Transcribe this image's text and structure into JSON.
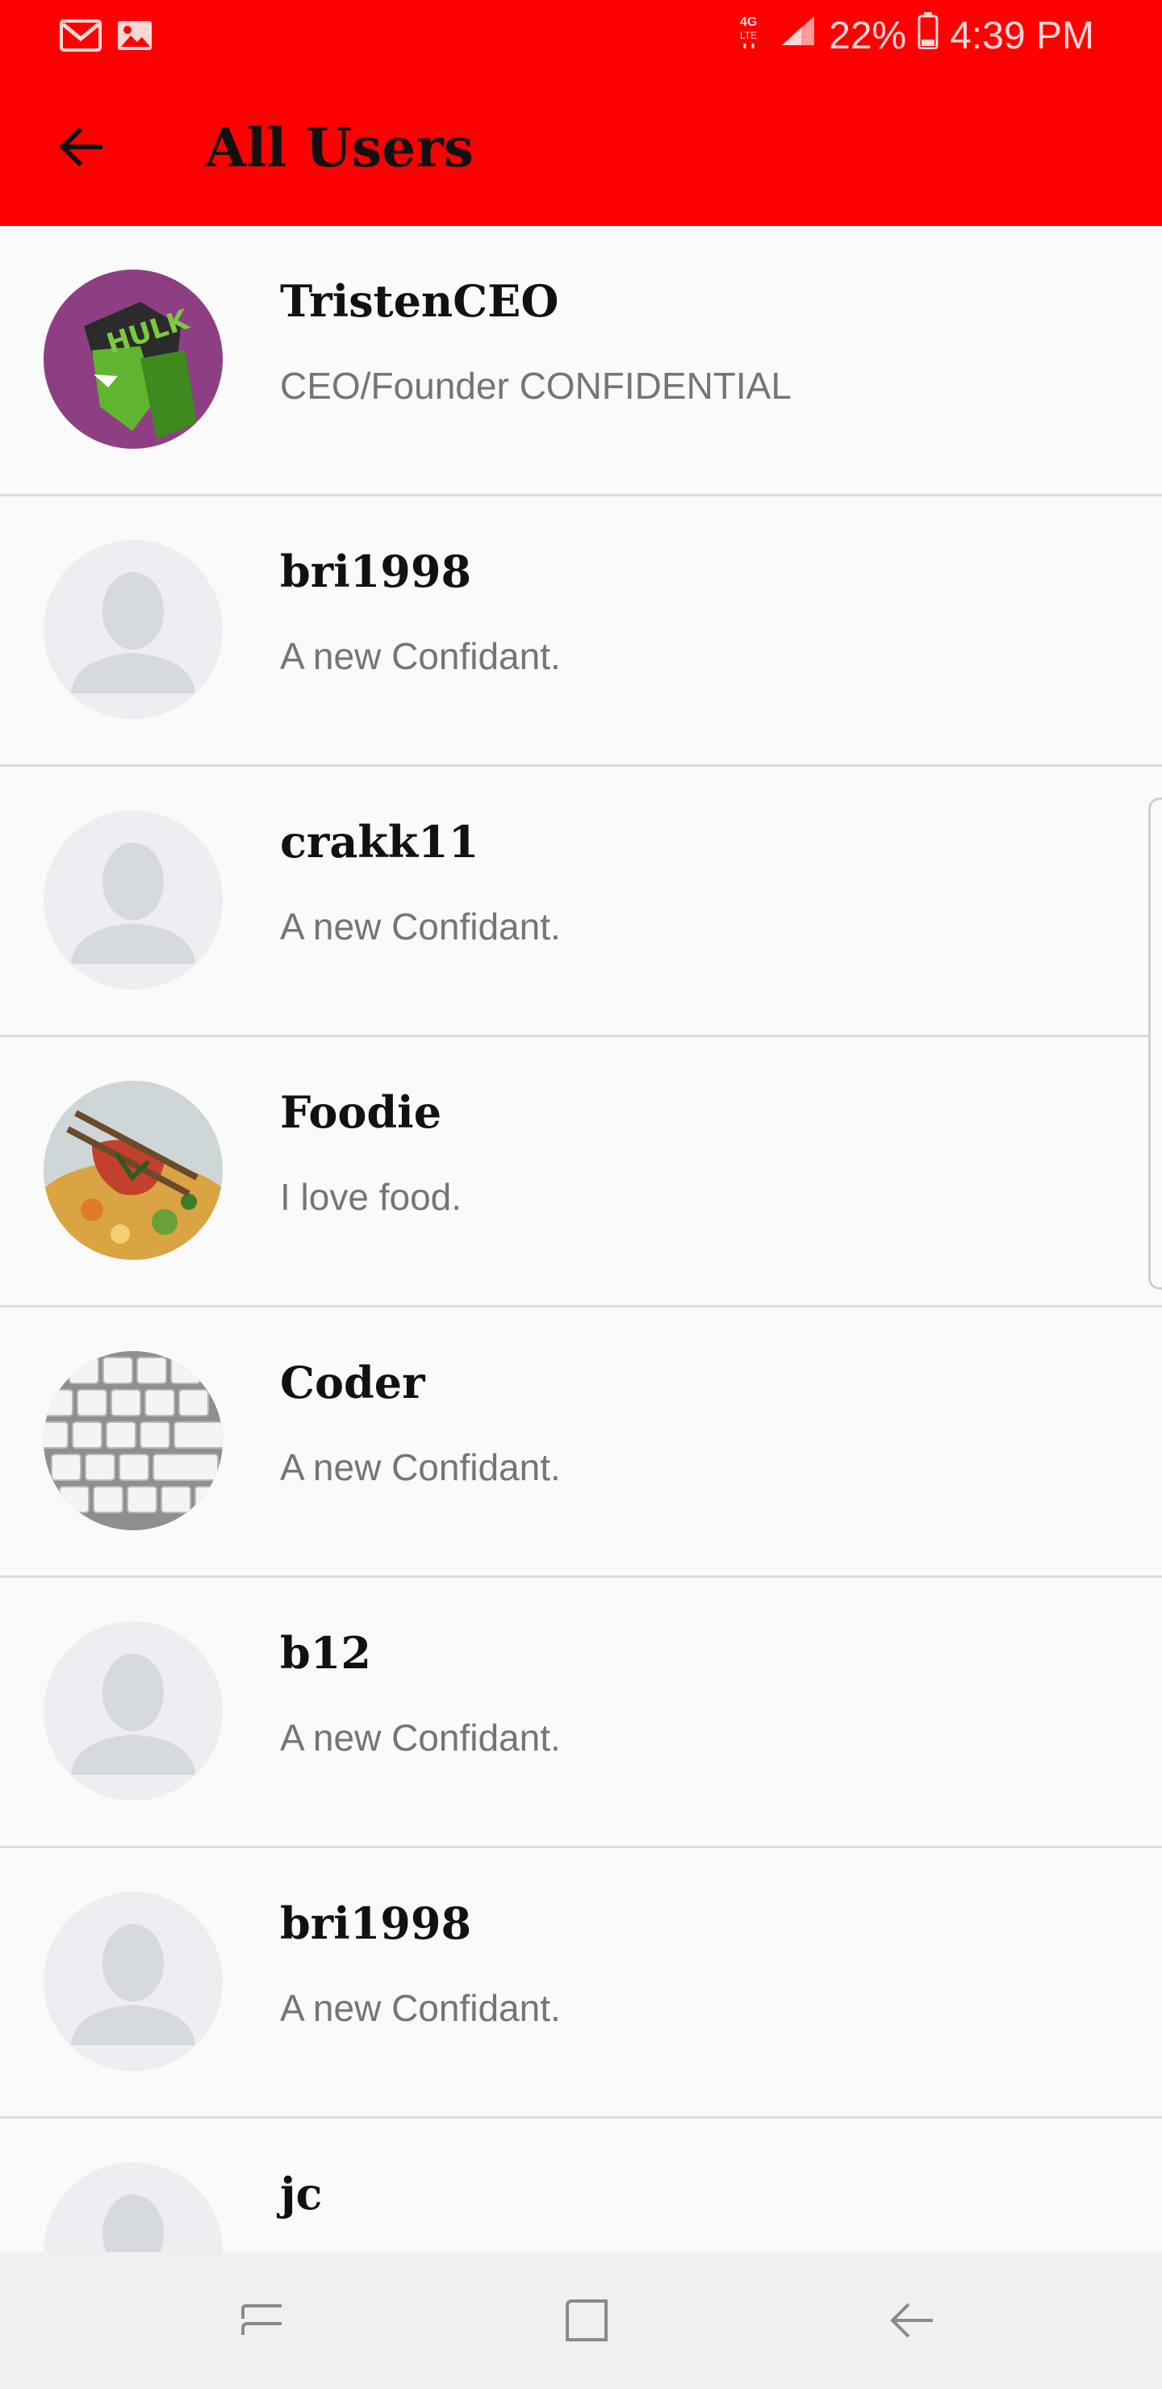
{
  "status_bar": {
    "battery": "22%",
    "time": "4:39 PM",
    "network": "4G LTE"
  },
  "header": {
    "title": "All Users"
  },
  "users": [
    {
      "name": "TristenCEO",
      "status": "CEO/Founder CONFIDENTIAL",
      "avatar": "hulk-avatar"
    },
    {
      "name": "bri1998",
      "status": "A new Confidant.",
      "avatar": "default-avatar"
    },
    {
      "name": "crakk11",
      "status": "A new Confidant.",
      "avatar": "default-avatar"
    },
    {
      "name": "Foodie",
      "status": "I love food.",
      "avatar": "food-avatar"
    },
    {
      "name": "Coder",
      "status": "A new Confidant.",
      "avatar": "keyboard-avatar"
    },
    {
      "name": "b12",
      "status": "A new Confidant.",
      "avatar": "default-avatar"
    },
    {
      "name": "bri1998",
      "status": "A new Confidant.",
      "avatar": "default-avatar"
    },
    {
      "name": "jc",
      "status": "",
      "avatar": "default-avatar"
    }
  ],
  "colors": {
    "app_bar": "#ff0000",
    "background": "#fafafa",
    "divider": "#dcdcdc",
    "name_text": "#111111",
    "status_text": "#757575"
  }
}
